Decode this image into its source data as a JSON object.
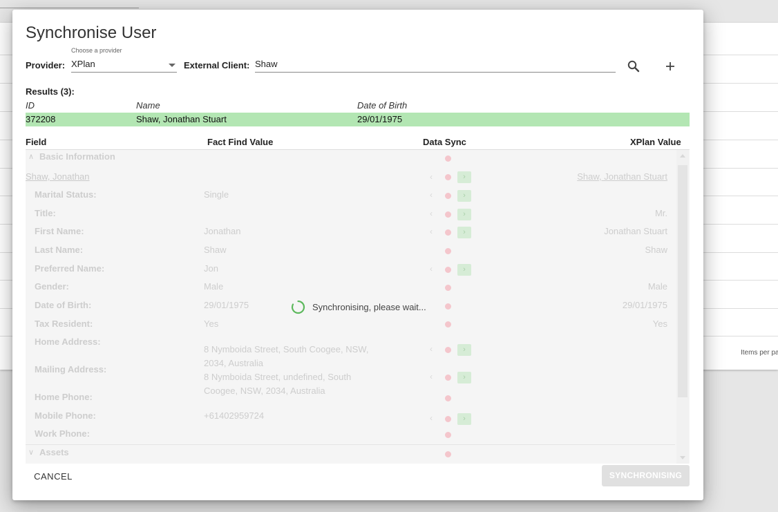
{
  "background": {
    "items_per_page": "Items per pa"
  },
  "dialog": {
    "title": "Synchronise User",
    "provider_label": "Provider:",
    "provider_hint": "Choose a provider",
    "provider_value": "XPlan",
    "external_client_label": "External Client:",
    "external_client_value": "Shaw",
    "results_label": "Results (3):",
    "results_headers": {
      "id": "ID",
      "name": "Name",
      "dob": "Date of Birth"
    },
    "selected_result": {
      "id": "372208",
      "name": "Shaw, Jonathan Stuart",
      "dob": "29/01/1975"
    },
    "columns": {
      "field": "Field",
      "fact_find": "Fact Find Value",
      "data_sync": "Data Sync",
      "xplan": "XPlan Value"
    },
    "sections": {
      "basic": "Basic Information",
      "assets": "Assets"
    },
    "person": {
      "fact_find": "Shaw, Jonathan",
      "xplan": "Shaw, Jonathan Stuart"
    },
    "rows": [
      {
        "label": "Marital Status:",
        "ff": "Single",
        "xp": ""
      },
      {
        "label": "Title:",
        "ff": "",
        "xp": "Mr."
      },
      {
        "label": "First Name:",
        "ff": "Jonathan",
        "xp": "Jonathan Stuart"
      },
      {
        "label": "Last Name:",
        "ff": "Shaw",
        "xp": "Shaw"
      },
      {
        "label": "Preferred Name:",
        "ff": "Jon",
        "xp": ""
      },
      {
        "label": "Gender:",
        "ff": "Male",
        "xp": "Male"
      },
      {
        "label": "Date of Birth:",
        "ff": "29/01/1975",
        "xp": "29/01/1975"
      },
      {
        "label": "Tax Resident:",
        "ff": "Yes",
        "xp": "Yes"
      },
      {
        "label": "Home Address:",
        "ff": "8 Nymboida Street, South Coogee, NSW, 2034, Australia",
        "xp": ""
      },
      {
        "label": "Mailing Address:",
        "ff": "8 Nymboida Street, undefined, South Coogee, NSW, 2034, Australia",
        "xp": ""
      },
      {
        "label": "Home Phone:",
        "ff": "",
        "xp": ""
      },
      {
        "label": "Mobile Phone:",
        "ff": "+61402959724",
        "xp": ""
      },
      {
        "label": "Work Phone:",
        "ff": "",
        "xp": ""
      }
    ],
    "sync_message": "Synchronising, please wait...",
    "cancel_label": "CANCEL",
    "submit_label": "SYNCHRONISING",
    "colors": {
      "selected_row": "#b3e6b3",
      "spinner": "#5cb85c",
      "dot": "#f4c6cc"
    }
  }
}
